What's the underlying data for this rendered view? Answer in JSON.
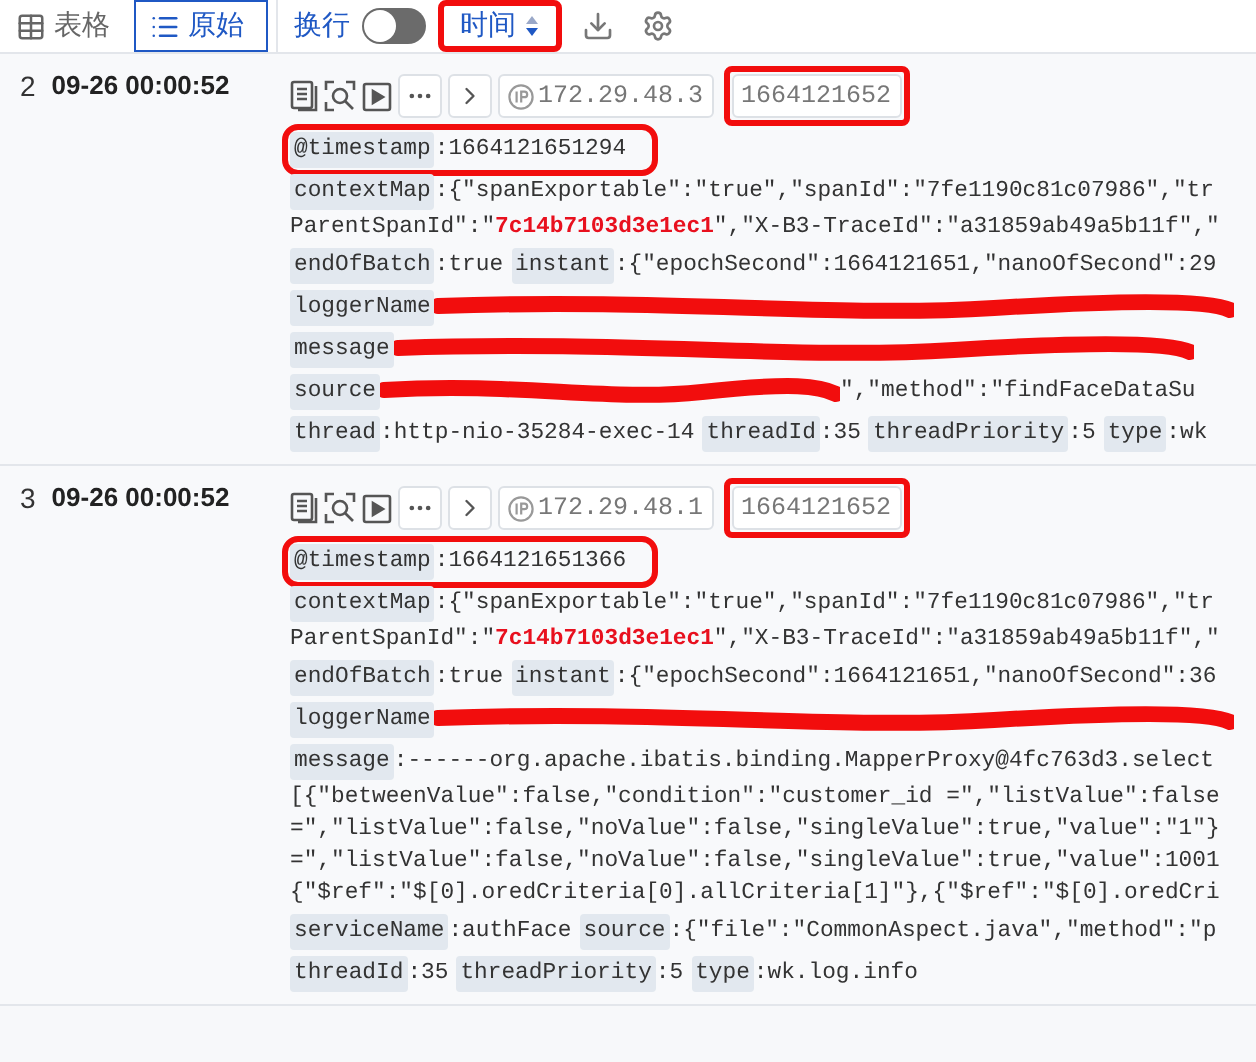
{
  "toolbar": {
    "view_tabs": [
      {
        "label": "表格",
        "kind": "table",
        "selected": false
      },
      {
        "label": "原始",
        "kind": "raw",
        "selected": true
      }
    ],
    "wrap": {
      "label": "换行",
      "on": false
    },
    "sort": {
      "label": "时间",
      "highlighted": true
    }
  },
  "entries": [
    {
      "index": "2",
      "time": "09-26 00:00:52",
      "ip": "172.29.48.3",
      "tag": {
        "text": "1664121652",
        "highlighted": true
      },
      "lines": [
        {
          "kind": "fields",
          "fields": [
            {
              "key": "@timestamp",
              "value": ":1664121651294",
              "highlighted": true
            }
          ]
        },
        {
          "kind": "fields",
          "fields": [
            {
              "key": "contextMap",
              "value": ":{\"spanExportable\":\"true\",\"spanId\":\"7fe1190c81c07986\",\"tr"
            }
          ]
        },
        {
          "kind": "text",
          "text": "ParentSpanId\":\"**7c14b7103d3e1ec1**\",\"X-B3-TraceId\":\"a31859ab49a5b11f\",\""
        },
        {
          "kind": "fields",
          "fields": [
            {
              "key": "endOfBatch",
              "value": ":true"
            },
            {
              "key": "instant",
              "value": ":{\"epochSecond\":1664121651,\"nanoOfSecond\":29"
            }
          ]
        },
        {
          "kind": "fields",
          "fields": [
            {
              "key": "loggerName",
              "redacted": true
            }
          ]
        },
        {
          "kind": "fields",
          "fields": [
            {
              "key": "message",
              "redacted": true
            }
          ]
        },
        {
          "kind": "fields",
          "fields": [
            {
              "key": "source",
              "value": "\",\"method\":\"findFaceDataSu",
              "redacted": true
            }
          ]
        },
        {
          "kind": "fields",
          "fields": [
            {
              "key": "thread",
              "value": ":http-nio-35284-exec-14"
            },
            {
              "key": "threadId",
              "value": ":35"
            },
            {
              "key": "threadPriority",
              "value": ":5"
            },
            {
              "key": "type",
              "value": ":wk"
            }
          ]
        }
      ]
    },
    {
      "index": "3",
      "time": "09-26 00:00:52",
      "ip": "172.29.48.1",
      "tag": {
        "text": "1664121652",
        "highlighted": true
      },
      "lines": [
        {
          "kind": "fields",
          "fields": [
            {
              "key": "@timestamp",
              "value": ":1664121651366",
              "highlighted": true
            }
          ]
        },
        {
          "kind": "fields",
          "fields": [
            {
              "key": "contextMap",
              "value": ":{\"spanExportable\":\"true\",\"spanId\":\"7fe1190c81c07986\",\"tr"
            }
          ]
        },
        {
          "kind": "text",
          "text": "ParentSpanId\":\"**7c14b7103d3e1ec1**\",\"X-B3-TraceId\":\"a31859ab49a5b11f\",\""
        },
        {
          "kind": "fields",
          "fields": [
            {
              "key": "endOfBatch",
              "value": ":true"
            },
            {
              "key": "instant",
              "value": ":{\"epochSecond\":1664121651,\"nanoOfSecond\":36"
            }
          ]
        },
        {
          "kind": "fields",
          "fields": [
            {
              "key": "loggerName",
              "redacted": true
            }
          ]
        },
        {
          "kind": "fields",
          "fields": [
            {
              "key": "message",
              "value": ":------org.apache.ibatis.binding.MapperProxy@4fc763d3.select"
            }
          ]
        },
        {
          "kind": "text",
          "text": "[{\"betweenValue\":false,\"condition\":\"customer_id =\",\"listValue\":false"
        },
        {
          "kind": "text",
          "text": "=\",\"listValue\":false,\"noValue\":false,\"singleValue\":true,\"value\":\"1\"}"
        },
        {
          "kind": "text",
          "text": "=\",\"listValue\":false,\"noValue\":false,\"singleValue\":true,\"value\":1001"
        },
        {
          "kind": "text",
          "text": "{\"$ref\":\"$[0].oredCriteria[0].allCriteria[1]\"},{\"$ref\":\"$[0].oredCri"
        },
        {
          "kind": "fields",
          "fields": [
            {
              "key": "serviceName",
              "value": ":authFace"
            },
            {
              "key": "source",
              "value": ":{\"file\":\"CommonAspect.java\",\"method\":\"p"
            }
          ]
        },
        {
          "kind": "fields",
          "fields": [
            {
              "key": "threadId",
              "value": ":35"
            },
            {
              "key": "threadPriority",
              "value": ":5"
            },
            {
              "key": "type",
              "value": ":wk.log.info"
            }
          ]
        }
      ]
    }
  ]
}
